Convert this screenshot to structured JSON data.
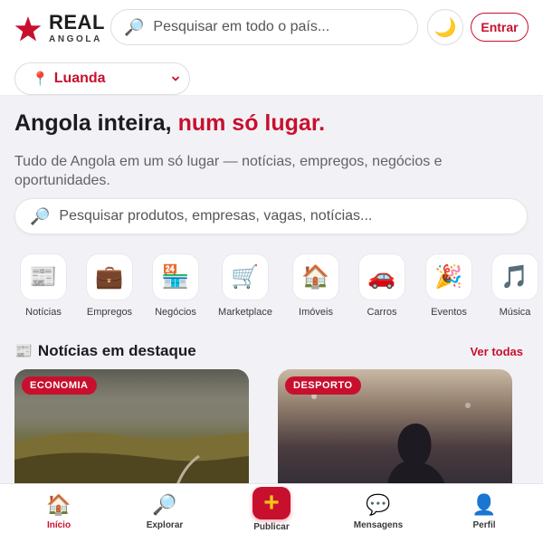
{
  "brand": {
    "name": "REAL",
    "sub": "ANGOLA",
    "accent_color": "#c8102e"
  },
  "header": {
    "search_placeholder": "Pesquisar em todo o país...",
    "search_icon": "🔎",
    "theme_icon": "🌙",
    "login_label": "Entrar",
    "city": {
      "label": "Luanda",
      "icon": "📍"
    }
  },
  "hero": {
    "title_main": "Angola inteira, ",
    "title_accent": "num só lugar.",
    "subtitle": "Tudo de Angola em um só lugar — notícias, empregos, negócios e oportunidades."
  },
  "main_search": {
    "placeholder": "Pesquisar produtos, empresas, vagas, notícias...",
    "icon": "🔎"
  },
  "categories": [
    {
      "label": "Notícias",
      "icon": "📰"
    },
    {
      "label": "Empregos",
      "icon": "💼"
    },
    {
      "label": "Negócios",
      "icon": "🏪"
    },
    {
      "label": "Marketplace",
      "icon": "🛒"
    },
    {
      "label": "Imóveis",
      "icon": "🏠"
    },
    {
      "label": "Carros",
      "icon": "🚗"
    },
    {
      "label": "Eventos",
      "icon": "🎉"
    },
    {
      "label": "Música",
      "icon": "🎵"
    }
  ],
  "featured": {
    "icon": "📰",
    "title": "Notícias em destaque",
    "see_all": "Ver todas",
    "cards": [
      {
        "badge": "ECONOMIA"
      },
      {
        "badge": "DESPORTO"
      }
    ]
  },
  "bottom_nav": [
    {
      "label": "Início",
      "icon": "🏠"
    },
    {
      "label": "Explorar",
      "icon": "🔎"
    },
    {
      "label": "Publicar",
      "icon": "+"
    },
    {
      "label": "Mensagens",
      "icon": "💬"
    },
    {
      "label": "Perfil",
      "icon": "👤"
    }
  ]
}
